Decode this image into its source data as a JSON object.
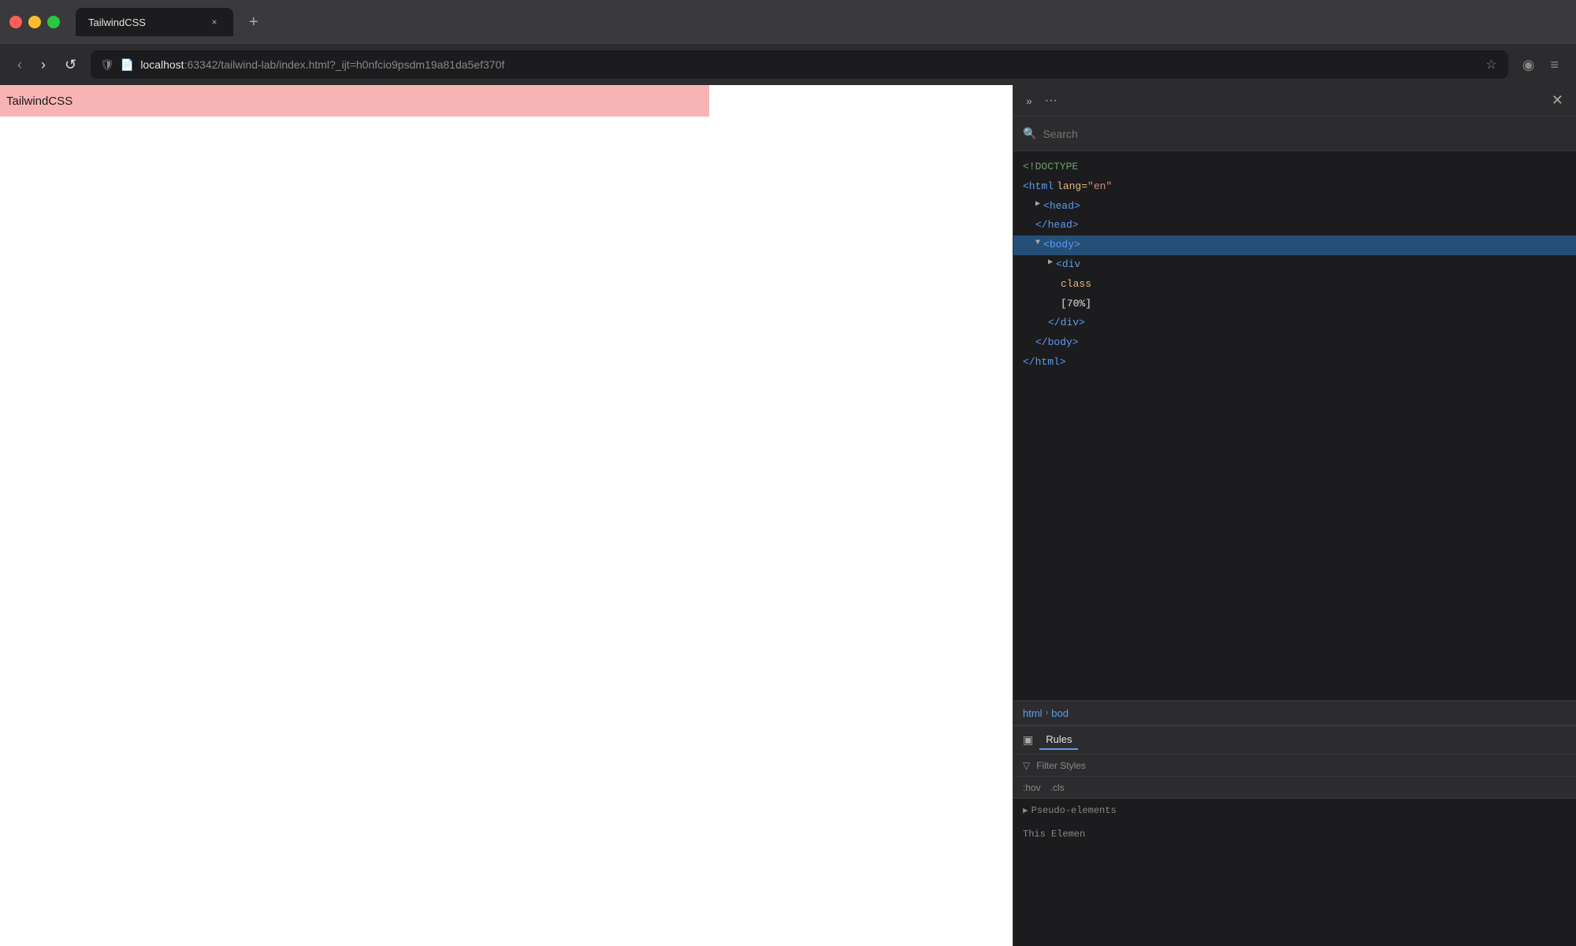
{
  "browser": {
    "tab": {
      "title": "TailwindCSS",
      "close_label": "×"
    },
    "new_tab_label": "+",
    "nav": {
      "back_label": "‹",
      "forward_label": "›",
      "reload_label": "↺",
      "url": "localhost:63342/tailwind-lab/index.html?_ijt=h0nfcio9psdm19a81da5ef370f",
      "url_host": "localhost",
      "url_path": ":63342/tailwind-lab/index.html?_ijt=h0nfcio9psdm19a81da5ef370f",
      "star_label": "☆",
      "profile_label": "◉",
      "menu_label": "≡"
    }
  },
  "page": {
    "title": "TailwindCSS",
    "pink_bar_bg": "#f8b4b4"
  },
  "devtools": {
    "toolbar": {
      "expand_label": "»",
      "more_label": "···",
      "close_label": "✕"
    },
    "search": {
      "placeholder": "Search",
      "icon": "🔍"
    },
    "dom": {
      "lines": [
        {
          "indent": 0,
          "content": "<!DOCTYPE",
          "type": "comment",
          "suffix": ""
        },
        {
          "indent": 0,
          "content": "<html",
          "type": "tag",
          "attr_name": "lang",
          "attr_value": "\"en\"",
          "suffix": ""
        },
        {
          "indent": 1,
          "content": "<head>",
          "type": "tag",
          "expandable": true,
          "suffix": ""
        },
        {
          "indent": 1,
          "content": "</head>",
          "type": "tag",
          "suffix": ""
        },
        {
          "indent": 1,
          "content": "<body>",
          "type": "tag",
          "selected": true,
          "expandable": true,
          "suffix": ""
        },
        {
          "indent": 2,
          "content": "<div",
          "type": "tag",
          "expandable": true,
          "suffix": ""
        },
        {
          "indent": 3,
          "content": "class",
          "type": "attr",
          "attr_value": "",
          "suffix": ""
        },
        {
          "indent": 3,
          "content": "[70%]",
          "type": "text",
          "suffix": ""
        },
        {
          "indent": 2,
          "content": "</div>",
          "type": "tag",
          "suffix": ""
        },
        {
          "indent": 1,
          "content": "</body>",
          "type": "tag",
          "suffix": ""
        },
        {
          "indent": 0,
          "content": "</html>",
          "type": "tag",
          "suffix": ""
        }
      ]
    },
    "breadcrumb": {
      "items": [
        "html",
        "bod"
      ]
    },
    "styles": {
      "rules_label": "Rules",
      "filter_label": "Filter Styles",
      "pseudo_items": [
        ":hov",
        ".cls"
      ],
      "pseudo_arrow": "▸",
      "section_heading": "Pseudo-elements",
      "this_element_label": "This Elemen"
    }
  }
}
